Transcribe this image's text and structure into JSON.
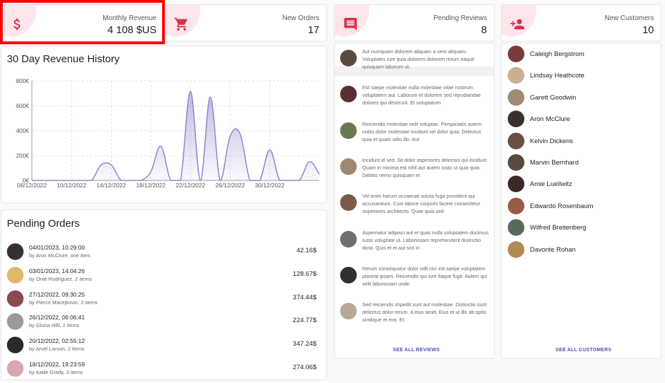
{
  "stats": {
    "monthly_revenue": {
      "label": "Monthly Revenue",
      "value": "4 108 $US",
      "icon": "dollar-icon"
    },
    "new_orders": {
      "label": "New Orders",
      "value": "17",
      "icon": "cart-icon"
    },
    "pending_reviews": {
      "label": "Pending Reviews",
      "value": "8",
      "icon": "comment-icon"
    },
    "new_customers": {
      "label": "New Customers",
      "value": "10",
      "icon": "person-add-icon"
    }
  },
  "accent_color": "#dc2f4f",
  "revenue_chart": {
    "title": "30 Day Revenue History"
  },
  "chart_data": {
    "type": "area",
    "title": "30 Day Revenue History",
    "xlabel": "",
    "ylabel": "",
    "x_ticks": [
      "06/12/2022",
      "10/12/2022",
      "14/12/2022",
      "18/12/2022",
      "22/12/2022",
      "26/12/2022",
      "30/12/2022"
    ],
    "y_ticks": [
      "0€",
      "200€",
      "400€",
      "600€",
      "800€"
    ],
    "ylim": [
      0,
      800
    ],
    "grid": true,
    "color": "#8b85cf",
    "x": [
      "06/12/2022",
      "07/12/2022",
      "08/12/2022",
      "09/12/2022",
      "10/12/2022",
      "11/12/2022",
      "12/12/2022",
      "13/12/2022",
      "14/12/2022",
      "15/12/2022",
      "16/12/2022",
      "17/12/2022",
      "18/12/2022",
      "19/12/2022",
      "20/12/2022",
      "21/12/2022",
      "22/12/2022",
      "23/12/2022",
      "24/12/2022",
      "25/12/2022",
      "26/12/2022",
      "27/12/2022",
      "28/12/2022",
      "29/12/2022",
      "30/12/2022",
      "31/12/2022",
      "01/01/2023",
      "02/01/2023",
      "03/01/2023",
      "04/01/2023"
    ],
    "values": [
      0,
      0,
      0,
      0,
      0,
      0,
      0,
      125,
      125,
      0,
      0,
      0,
      70,
      275,
      0,
      0,
      715,
      0,
      670,
      0,
      355,
      375,
      0,
      0,
      245,
      0,
      0,
      0,
      150,
      50
    ]
  },
  "pending_orders": {
    "title": "Pending Orders",
    "items": [
      {
        "date": "04/01/2023, 10:29:00",
        "detail": "by Aron McClure, one item",
        "amount": "42.16$",
        "avatar_color": "#3a3030"
      },
      {
        "date": "03/01/2023, 14:04:26",
        "detail": "by Onie Rodriguez, 2 items",
        "amount": "128.67$",
        "avatar_color": "#e0b86a"
      },
      {
        "date": "27/12/2022, 09:30:25",
        "detail": "by Pierce Macejkovic, 2 items",
        "amount": "374.44$",
        "avatar_color": "#8a4a4f"
      },
      {
        "date": "26/12/2022, 06:06:41",
        "detail": "by Gloria Hilll, 2 items",
        "amount": "224.77$",
        "avatar_color": "#9a9a9a"
      },
      {
        "date": "20/12/2022, 02:55:12",
        "detail": "by Arvel Larson, 2 items",
        "amount": "347.24$",
        "avatar_color": "#2a2a2a"
      },
      {
        "date": "18/12/2022, 19:23:59",
        "detail": "by Kade Grady, 3 items",
        "amount": "274.06$",
        "avatar_color": "#d8a7b0"
      }
    ]
  },
  "reviews": {
    "items": [
      {
        "text": "Aut numquam dolorem aliquam a vero aliquam. Voluptates iure quia dolorem dolorem rerum eaque quisquam laborum ut.",
        "avatar_color": "#5a4a40"
      },
      {
        "text": "Est saepe molestiae nulla molestiae vitae nostrum voluptatem aut. Laborum et dolorem sed repudiandae dolores qui deserunt. Et voluptatum",
        "avatar_color": "#5a3030"
      },
      {
        "text": "Reiciendis molestiae velit voluptas. Perspiciatis autem nobis dolor molestiae incidunt vel dolor quia. Delectus quia et quam odio illo. Aut",
        "avatar_color": "#6a7a50"
      },
      {
        "text": "Incidunt id sed. Sit dolor asperiores delectus qui incidunt. Quam in minima est nihil aut autem iusto ut quia quia. Debitis nemo quisquam et",
        "avatar_color": "#a08870"
      },
      {
        "text": "Vel enim harum occaecati soluta fuga provident qui accusantium. Cum labore corporis facere consectetur asperiores architecto. Quae quia sed",
        "avatar_color": "#7a5a48"
      },
      {
        "text": "Aspernatur adipisci aut et quas nulla voluptatem ducimus. Iusto voluptate ut. Laboriosam reprehenderit distinctio dicta. Quis et et aut sint in",
        "avatar_color": "#707070"
      },
      {
        "text": "Rerum consequatur dolor odit nisi est saepe voluptatem placeat ipsam. Reiciendis qui iure itaque fugit. Autem qui velit laboriosam unde.",
        "avatar_color": "#303030"
      },
      {
        "text": "Sed reiciendis impedit sunt aut molestiae. Distinctio sunt delectus dolor rerum. A eius amet. Eius et ut illo ab optio similique et eos. Et",
        "avatar_color": "#b8a898"
      }
    ],
    "see_all": "SEE ALL REVIEWS"
  },
  "customers": {
    "items": [
      {
        "name": "Caleigh Bergstrom",
        "avatar_color": "#7a3a3a"
      },
      {
        "name": "Lindsay Heathcote",
        "avatar_color": "#c8b090"
      },
      {
        "name": "Garett Goodwin",
        "avatar_color": "#a08a70"
      },
      {
        "name": "Aron McClure",
        "avatar_color": "#3a3030"
      },
      {
        "name": "Kelvin Dickens",
        "avatar_color": "#6a5040"
      },
      {
        "name": "Marvin Bernhard",
        "avatar_color": "#5a4a40"
      },
      {
        "name": "Amie Lueilwitz",
        "avatar_color": "#3a2a28"
      },
      {
        "name": "Edwardo Rosenbaum",
        "avatar_color": "#9a5a4a"
      },
      {
        "name": "Wilfred Breitenberg",
        "avatar_color": "#5a6a5a"
      },
      {
        "name": "Davonte Rohan",
        "avatar_color": "#b08a50"
      }
    ],
    "see_all": "SEE ALL CUSTOMERS"
  }
}
